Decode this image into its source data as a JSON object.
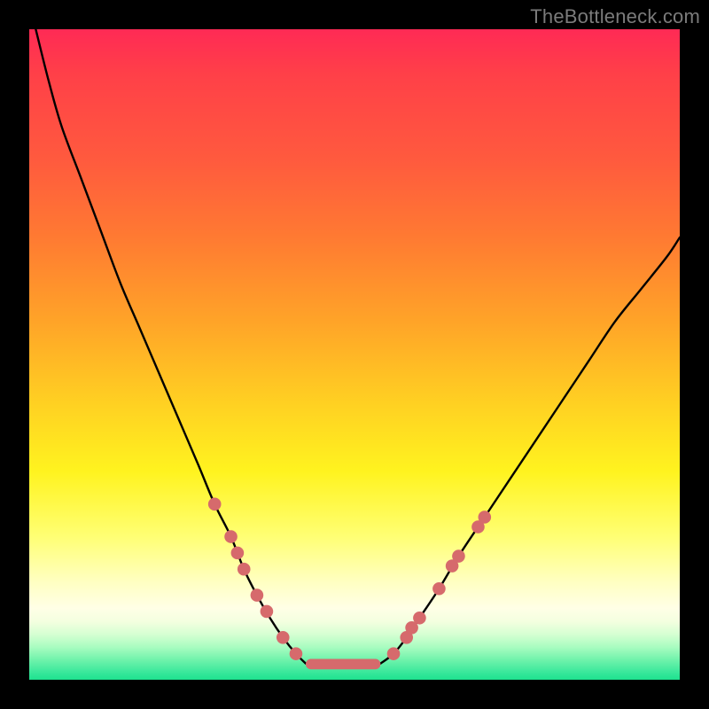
{
  "watermark": "TheBottleneck.com",
  "colors": {
    "background": "#000000",
    "curve_stroke": "#000000",
    "marker_fill": "#d66a6c",
    "plateau_fill": "#d66a6c",
    "gradient_top": "#ff2a55",
    "gradient_bottom": "#1ee28f"
  },
  "chart_data": {
    "type": "line",
    "title": "",
    "xlabel": "",
    "ylabel": "",
    "xlim": [
      0,
      100
    ],
    "ylim": [
      0,
      100
    ],
    "grid": false,
    "legend": false,
    "series": [
      {
        "name": "left-curve",
        "x": [
          1,
          3,
          5,
          8,
          11,
          14,
          17,
          20,
          23,
          26,
          28.5,
          31,
          33,
          35,
          37,
          39,
          41,
          42.5
        ],
        "y": [
          100,
          92,
          85,
          77,
          69,
          61,
          54,
          47,
          40,
          33,
          27,
          22,
          17,
          13,
          9.5,
          6.5,
          4,
          2.5
        ]
      },
      {
        "name": "right-curve",
        "x": [
          54,
          56,
          58,
          60,
          63,
          66,
          70,
          74,
          78,
          82,
          86,
          90,
          94,
          98,
          100
        ],
        "y": [
          2.5,
          4,
          6.5,
          9.5,
          14,
          19,
          25,
          31,
          37,
          43,
          49,
          55,
          60,
          65,
          68
        ]
      },
      {
        "name": "plateau",
        "x": [
          42.5,
          54
        ],
        "y": [
          2.5,
          2.5
        ]
      }
    ],
    "markers_left": [
      {
        "x": 28.5,
        "y": 27
      },
      {
        "x": 31,
        "y": 22
      },
      {
        "x": 32,
        "y": 19.5
      },
      {
        "x": 33,
        "y": 17
      },
      {
        "x": 35,
        "y": 13
      },
      {
        "x": 36.5,
        "y": 10.5
      },
      {
        "x": 39,
        "y": 6.5
      },
      {
        "x": 41,
        "y": 4
      }
    ],
    "markers_right": [
      {
        "x": 56,
        "y": 4
      },
      {
        "x": 58,
        "y": 6.5
      },
      {
        "x": 58.8,
        "y": 8
      },
      {
        "x": 60,
        "y": 9.5
      },
      {
        "x": 63,
        "y": 14
      },
      {
        "x": 65,
        "y": 17.5
      },
      {
        "x": 66,
        "y": 19
      },
      {
        "x": 69,
        "y": 23.5
      },
      {
        "x": 70,
        "y": 25
      }
    ],
    "plateau_segment": {
      "x0": 42.5,
      "x1": 54,
      "y": 2.4,
      "thickness_pct": 1.6
    }
  }
}
